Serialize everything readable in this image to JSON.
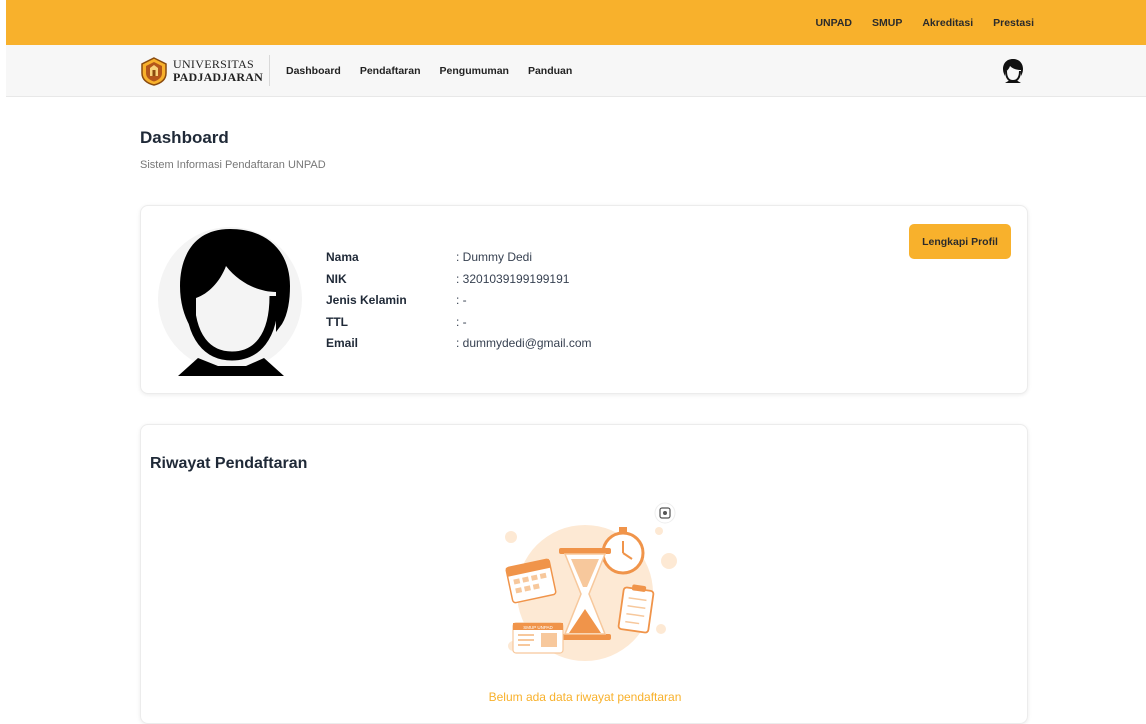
{
  "topbar": {
    "links": [
      "UNPAD",
      "SMUP",
      "Akreditasi",
      "Prestasi"
    ]
  },
  "brand": {
    "line1": "UNIVERSITAS",
    "line2": "PADJADJARAN"
  },
  "nav": {
    "items": [
      "Dashboard",
      "Pendaftaran",
      "Pengumuman",
      "Panduan"
    ]
  },
  "page": {
    "title": "Dashboard",
    "subtitle": "Sistem Informasi Pendaftaran UNPAD"
  },
  "profile": {
    "button_label": "Lengkapi Profil",
    "fields": [
      {
        "label": "Nama",
        "value": ": Dummy Dedi"
      },
      {
        "label": "NIK",
        "value": ": 3201039199199191"
      },
      {
        "label": "Jenis Kelamin",
        "value": ": -"
      },
      {
        "label": "TTL",
        "value": ": -"
      },
      {
        "label": "Email",
        "value": ": dummydedi@gmail.com"
      }
    ]
  },
  "history": {
    "title": "Riwayat Pendaftaran",
    "empty_message": "Belum ada data riwayat pendaftaran",
    "illustration_label": "SMUP UNPAD"
  },
  "colors": {
    "accent": "#f8b12c",
    "illustration_orange": "#f0944a",
    "illustration_light": "#fde9d4"
  },
  "icons": {
    "logo": "unpad-logo-icon",
    "avatar": "user-avatar-icon",
    "illustration": "hourglass-calendar-illustration"
  }
}
